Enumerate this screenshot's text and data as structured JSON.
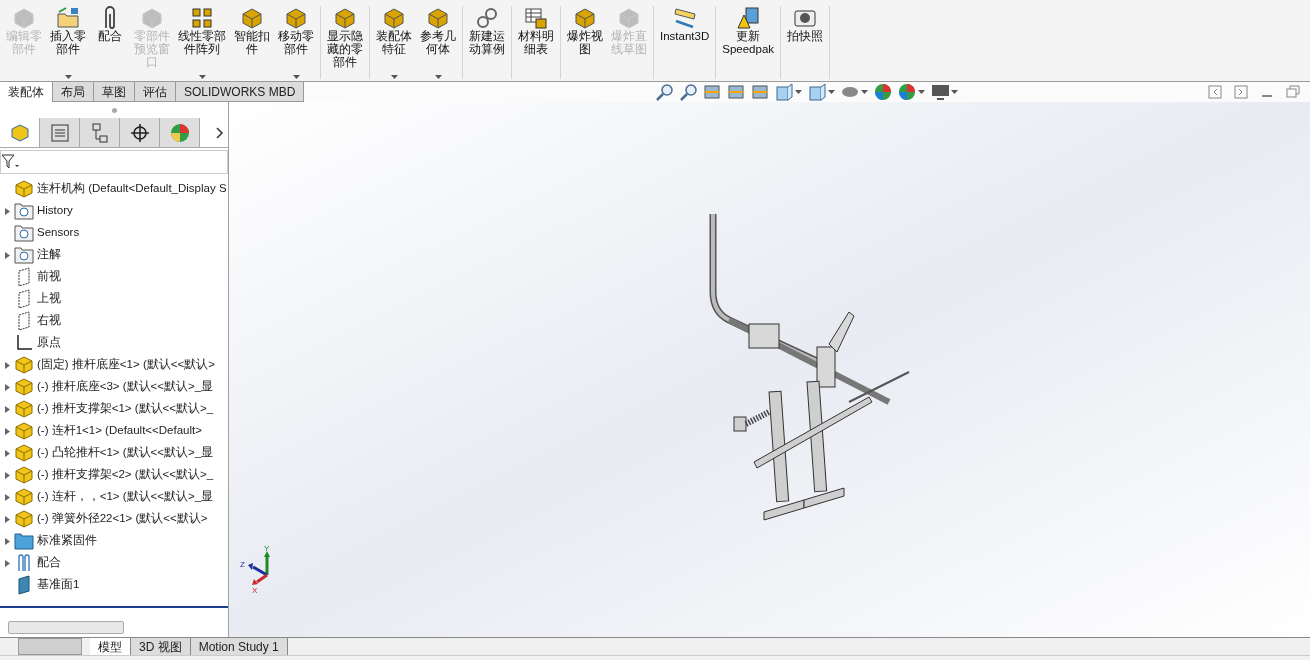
{
  "toolbar": {
    "groups": [
      {
        "items": [
          {
            "lines": [
              "编辑零",
              "部件"
            ],
            "disabled": true,
            "dropdown": false
          },
          {
            "lines": [
              "插入零",
              "部件"
            ],
            "disabled": false,
            "dropdown": true
          },
          {
            "lines": [
              "配合"
            ],
            "disabled": false,
            "dropdown": false
          },
          {
            "lines": [
              "零部件",
              "预览窗",
              "口"
            ],
            "disabled": true,
            "dropdown": false
          },
          {
            "lines": [
              "线性零部",
              "件阵列"
            ],
            "disabled": false,
            "dropdown": true
          },
          {
            "lines": [
              "智能扣",
              "件"
            ],
            "disabled": false,
            "dropdown": false
          },
          {
            "lines": [
              "移动零",
              "部件"
            ],
            "disabled": false,
            "dropdown": true
          }
        ]
      },
      {
        "items": [
          {
            "lines": [
              "显示隐",
              "藏的零",
              "部件"
            ],
            "disabled": false,
            "dropdown": false
          }
        ]
      },
      {
        "items": [
          {
            "lines": [
              "装配体",
              "特征"
            ],
            "disabled": false,
            "dropdown": true
          },
          {
            "lines": [
              "参考几",
              "何体"
            ],
            "disabled": false,
            "dropdown": true
          }
        ]
      },
      {
        "items": [
          {
            "lines": [
              "新建运",
              "动算例"
            ],
            "disabled": false,
            "dropdown": false
          }
        ]
      },
      {
        "items": [
          {
            "lines": [
              "材料明",
              "细表"
            ],
            "disabled": false,
            "dropdown": false
          }
        ]
      },
      {
        "items": [
          {
            "lines": [
              "爆炸视",
              "图"
            ],
            "disabled": false,
            "dropdown": false
          },
          {
            "lines": [
              "爆炸直",
              "线草图"
            ],
            "disabled": true,
            "dropdown": false
          }
        ]
      },
      {
        "items": [
          {
            "lines": [
              "Instant3D"
            ],
            "disabled": false,
            "dropdown": false
          }
        ]
      },
      {
        "items": [
          {
            "lines": [
              "更新",
              "Speedpak"
            ],
            "disabled": false,
            "dropdown": false
          }
        ]
      },
      {
        "items": [
          {
            "lines": [
              "拍快照"
            ],
            "disabled": false,
            "dropdown": false
          }
        ]
      }
    ]
  },
  "tabs": [
    {
      "label": "装配体",
      "selected": true
    },
    {
      "label": "布局",
      "selected": false
    },
    {
      "label": "草图",
      "selected": false
    },
    {
      "label": "评估",
      "selected": false
    },
    {
      "label": "SOLIDWORKS MBD",
      "selected": false
    }
  ],
  "panel_tabs": [
    {
      "selected": true
    },
    {
      "selected": false
    },
    {
      "selected": false
    },
    {
      "selected": false
    },
    {
      "selected": false
    }
  ],
  "tree": [
    {
      "kind": "root",
      "label": "连杆机构  (Default<Default_Display S",
      "expandable": false
    },
    {
      "kind": "history",
      "label": "History",
      "expandable": true
    },
    {
      "kind": "sensors",
      "label": "Sensors",
      "expandable": false
    },
    {
      "kind": "annotation",
      "label": "注解",
      "expandable": true
    },
    {
      "kind": "plane",
      "label": "前视",
      "expandable": false
    },
    {
      "kind": "plane",
      "label": "上视",
      "expandable": false
    },
    {
      "kind": "plane",
      "label": "右视",
      "expandable": false
    },
    {
      "kind": "origin",
      "label": "原点",
      "expandable": false
    },
    {
      "kind": "part",
      "label": "(固定) 推杆底座<1> (默认<<默认>",
      "expandable": true
    },
    {
      "kind": "part",
      "label": "(-) 推杆底座<3> (默认<<默认>_显",
      "expandable": true
    },
    {
      "kind": "part",
      "label": "(-) 推杆支撑架<1> (默认<<默认>_",
      "expandable": true
    },
    {
      "kind": "part",
      "label": "(-) 连杆1<1> (Default<<Default>",
      "expandable": true
    },
    {
      "kind": "part",
      "label": "(-) 凸轮推杆<1> (默认<<默认>_显",
      "expandable": true
    },
    {
      "kind": "part",
      "label": "(-) 推杆支撑架<2> (默认<<默认>_",
      "expandable": true
    },
    {
      "kind": "part",
      "label": "(-) 连杆，，<1> (默认<<默认>_显",
      "expandable": true
    },
    {
      "kind": "part",
      "label": "(-) 弹簧外径22<1> (默认<<默认>",
      "expandable": true
    },
    {
      "kind": "folder",
      "label": "标准紧固件",
      "expandable": true
    },
    {
      "kind": "mates",
      "label": "配合",
      "expandable": true
    },
    {
      "kind": "solid-plane",
      "label": "基准面1",
      "expandable": false
    }
  ],
  "view_tools": [
    {
      "dropdown": false
    },
    {
      "dropdown": false
    },
    {
      "dropdown": false
    },
    {
      "dropdown": false
    },
    {
      "dropdown": false
    },
    {
      "dropdown": true
    },
    {
      "dropdown": true
    },
    {
      "dropdown": true
    },
    {
      "dropdown": false
    },
    {
      "dropdown": true
    },
    {
      "dropdown": true
    }
  ],
  "triad": {
    "x": "X",
    "y": "Y",
    "z": "Z"
  },
  "bottom_tabs": [
    {
      "label": "模型",
      "selected": true
    },
    {
      "label": "3D 视图",
      "selected": false
    },
    {
      "label": "Motion Study 1",
      "selected": false
    }
  ]
}
